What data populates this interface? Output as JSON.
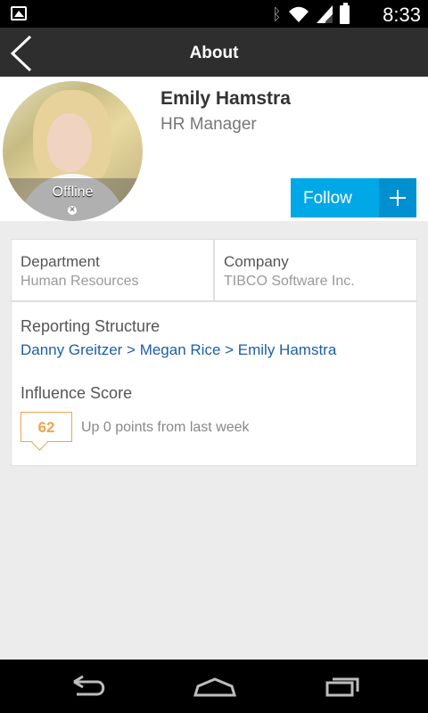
{
  "status_bar": {
    "time": "8:33",
    "icons": [
      "image-icon",
      "bluetooth-icon",
      "wifi-icon",
      "signal-icon",
      "battery-icon"
    ]
  },
  "header": {
    "title": "About"
  },
  "profile": {
    "name": "Emily Hamstra",
    "job_title": "HR Manager",
    "presence": "Offline",
    "follow_label": "Follow"
  },
  "info": {
    "department_label": "Department",
    "department_value": "Human Resources",
    "company_label": "Company",
    "company_value": "TIBCO Software Inc."
  },
  "reporting": {
    "label": "Reporting Structure",
    "chain": "Danny Greitzer > Megan Rice > Emily Hamstra"
  },
  "influence": {
    "label": "Influence Score",
    "score": "62",
    "summary": "Up 0 points from last week"
  },
  "colors": {
    "accent": "#00a8e8",
    "link": "#1d5ea8",
    "score": "#f0a44b",
    "header": "#2e2e2e"
  }
}
